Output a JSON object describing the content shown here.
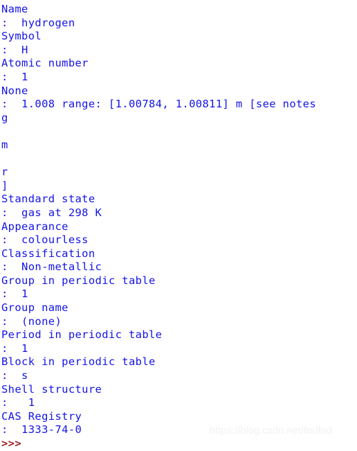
{
  "window": {
    "kind": "python-idle-shell",
    "background_color": "#ffffff",
    "output_color": "#1414e6",
    "prompt_color": "#9c2222",
    "watermark_color": "#f1f1f1"
  },
  "console": {
    "lines": [
      {
        "id": "line-1",
        "kind": "output",
        "text": "Name"
      },
      {
        "id": "line-2",
        "kind": "output",
        "text": ":  hydrogen"
      },
      {
        "id": "line-3",
        "kind": "output",
        "text": "Symbol"
      },
      {
        "id": "line-4",
        "kind": "output",
        "text": ":  H"
      },
      {
        "id": "line-5",
        "kind": "output",
        "text": "Atomic number"
      },
      {
        "id": "line-6",
        "kind": "output",
        "text": ":  1"
      },
      {
        "id": "line-7",
        "kind": "output",
        "text": "None"
      },
      {
        "id": "line-8",
        "kind": "output",
        "text": ":  1.008 range: [1.00784, 1.00811] m [see notes"
      },
      {
        "id": "line-9",
        "kind": "output",
        "text": "g"
      },
      {
        "id": "line-10",
        "kind": "blank",
        "text": " "
      },
      {
        "id": "line-11",
        "kind": "output",
        "text": "m"
      },
      {
        "id": "line-12",
        "kind": "blank",
        "text": " "
      },
      {
        "id": "line-13",
        "kind": "output",
        "text": "r"
      },
      {
        "id": "line-14",
        "kind": "output",
        "text": "]"
      },
      {
        "id": "line-15",
        "kind": "output",
        "text": "Standard state"
      },
      {
        "id": "line-16",
        "kind": "output",
        "text": ":  gas at 298 K"
      },
      {
        "id": "line-17",
        "kind": "output",
        "text": "Appearance"
      },
      {
        "id": "line-18",
        "kind": "output",
        "text": ":  colourless"
      },
      {
        "id": "line-19",
        "kind": "output",
        "text": "Classification"
      },
      {
        "id": "line-20",
        "kind": "output",
        "text": ":  Non-metallic"
      },
      {
        "id": "line-21",
        "kind": "output",
        "text": "Group in periodic table"
      },
      {
        "id": "line-22",
        "kind": "output",
        "text": ":  1"
      },
      {
        "id": "line-23",
        "kind": "output",
        "text": "Group name"
      },
      {
        "id": "line-24",
        "kind": "output",
        "text": ":  (none)"
      },
      {
        "id": "line-25",
        "kind": "output",
        "text": "Period in periodic table"
      },
      {
        "id": "line-26",
        "kind": "output",
        "text": ":  1"
      },
      {
        "id": "line-27",
        "kind": "output",
        "text": "Block in periodic table"
      },
      {
        "id": "line-28",
        "kind": "output",
        "text": ":  s"
      },
      {
        "id": "line-29",
        "kind": "output",
        "text": "Shell structure"
      },
      {
        "id": "line-30",
        "kind": "output",
        "text": ":   1"
      },
      {
        "id": "line-31",
        "kind": "output",
        "text": "CAS Registry"
      },
      {
        "id": "line-32",
        "kind": "output",
        "text": ":  1333-74-0"
      },
      {
        "id": "line-33",
        "kind": "prompt",
        "text": ">>>"
      }
    ]
  },
  "element_properties": {
    "name_label": "Name",
    "name_value": "hydrogen",
    "symbol_label": "Symbol",
    "symbol_value": "H",
    "atomic_number_label": "Atomic number",
    "atomic_number_value": "1",
    "atomic_weight_label": "None",
    "atomic_weight_value": "1.008 range: [1.00784, 1.00811] m [see notes",
    "standard_state_label": "Standard state",
    "standard_state_value": "gas at 298 K",
    "appearance_label": "Appearance",
    "appearance_value": "colourless",
    "classification_label": "Classification",
    "classification_value": "Non-metallic",
    "group_label": "Group in periodic table",
    "group_value": "1",
    "group_name_label": "Group name",
    "group_name_value": "(none)",
    "period_label": "Period in periodic table",
    "period_value": "1",
    "block_label": "Block in periodic table",
    "block_value": "s",
    "shell_structure_label": "Shell structure",
    "shell_structure_value": "1",
    "cas_registry_label": "CAS Registry",
    "cas_registry_value": "1333-74-0"
  },
  "watermark": {
    "text": "https://blog.csdn.net/fndfnd"
  }
}
